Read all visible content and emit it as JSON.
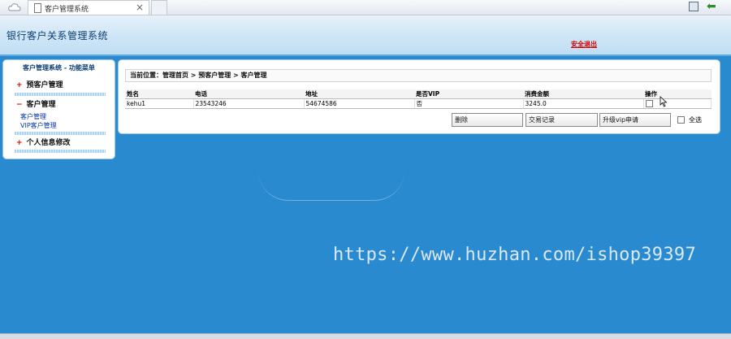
{
  "browser": {
    "tab_title": "客户管理系统",
    "tab_close": "×"
  },
  "header": {
    "app_title": "银行客户关系管理系统",
    "logout_label": "安全退出"
  },
  "sidebar": {
    "title": "客户管理系统 - 功能菜单",
    "items": [
      {
        "sign": "+",
        "label": "预客户管理"
      },
      {
        "sign": "−",
        "label": "客户管理"
      },
      {
        "sign": "+",
        "label": "个人信息修改"
      }
    ],
    "sub_items": [
      "客户管理",
      "VIP客户管理"
    ]
  },
  "main": {
    "breadcrumb": "当前位置：管理首页 > 预客户管理 > 客户管理",
    "columns": [
      "姓名",
      "电话",
      "地址",
      "是否VIP",
      "消费金额",
      "操作"
    ],
    "rows": [
      [
        "kehu1",
        "23543246",
        "54674586",
        "否",
        "3245.0"
      ]
    ],
    "buttons": {
      "delete": "删除",
      "transactions": "交易记录",
      "upgrade_vip": "升级vip申请"
    },
    "select_all": "全选"
  },
  "watermark": "https://www.huzhan.com/ishop39397"
}
